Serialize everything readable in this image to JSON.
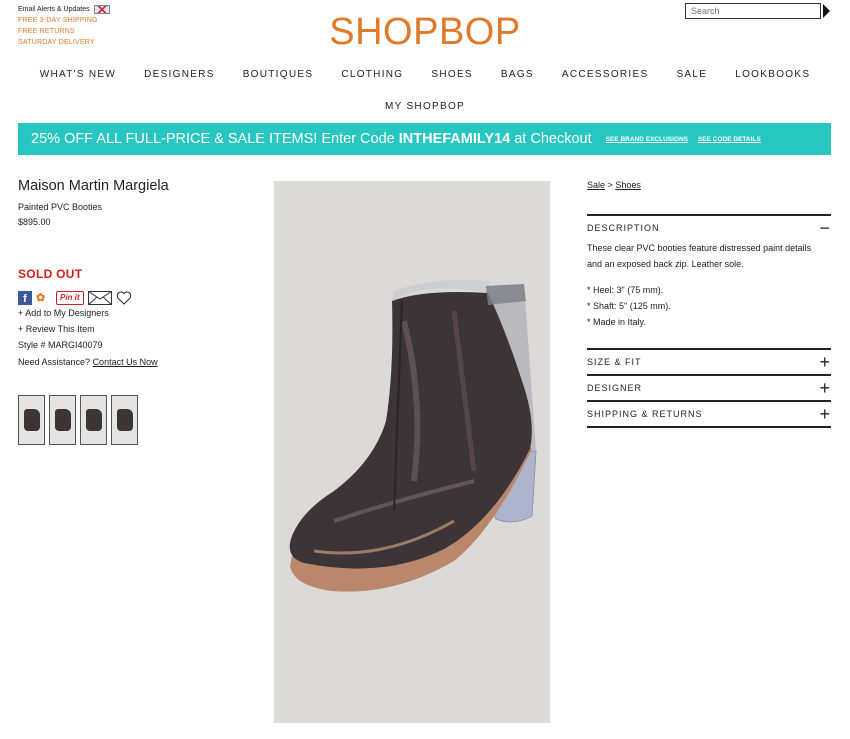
{
  "header": {
    "email_alerts": "Email Alerts & Updates",
    "promos": [
      "FREE 3-DAY SHIPPING",
      "FREE RETURNS",
      "SATURDAY DELIVERY"
    ],
    "logo": "SHOPBOP",
    "search_placeholder": "Search"
  },
  "nav": {
    "items": [
      "WHAT'S NEW",
      "DESIGNERS",
      "BOUTIQUES",
      "CLOTHING",
      "SHOES",
      "BAGS",
      "ACCESSORIES",
      "SALE",
      "LOOKBOOKS"
    ],
    "my_shopbop": "MY SHOPBOP"
  },
  "promo": {
    "text_before": "25% OFF ALL FULL-PRICE & SALE ITEMS!  Enter Code ",
    "code": "INTHEFAMILY14",
    "text_after": " at Checkout",
    "link1": "SEE BRAND EXCLUSIONS",
    "link2": "SEE CODE DETAILS",
    "color": "#27c6c1"
  },
  "product": {
    "brand": "Maison Martin Margiela",
    "name": "Painted PVC Booties",
    "price": "$895.00",
    "status": "SOLD OUT",
    "add_designer": "+ Add to My Designers",
    "review": "+ Review This Item",
    "style": "Style # MARGI40079",
    "assist_label": "Need Assistance?",
    "assist_link": "Contact Us Now"
  },
  "breadcrumb": {
    "item1": "Sale",
    "sep": ">",
    "item2": "Shoes"
  },
  "accordion": {
    "description": {
      "title": "DESCRIPTION",
      "icon": "−",
      "para": "These clear PVC booties feature distressed paint details and an exposed back zip. Leather sole.",
      "bullets": [
        "* Heel: 3\" (75 mm).",
        "* Shaft: 5\" (125 mm).",
        "* Made in Italy."
      ]
    },
    "size_fit": {
      "title": "SIZE & FIT",
      "icon": "+"
    },
    "designer": {
      "title": "DESIGNER",
      "icon": "+"
    },
    "shipping": {
      "title": "SHIPPING & RETURNS",
      "icon": "+"
    }
  }
}
